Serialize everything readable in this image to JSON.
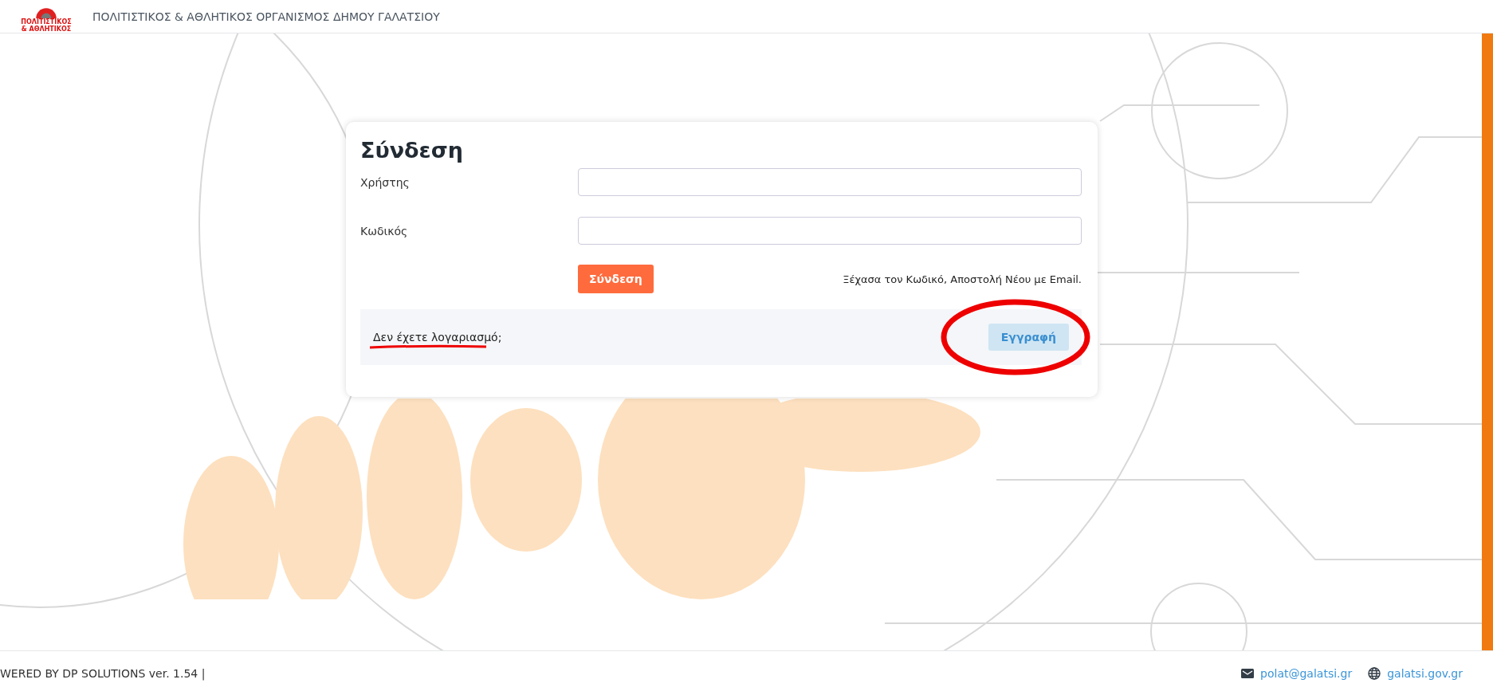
{
  "header": {
    "logo": {
      "line_1": "ΠΟΛΙΤΙΣΤΙΚΟΣ",
      "line_2": "& ΑΘΛΗΤΙΚΟΣ"
    },
    "title": "ΠΟΛΙΤΙΣΤΙΚΟΣ & ΑΘΛΗΤΙΚΟΣ ΟΡΓΑΝΙΣΜΟΣ ΔΗΜΟΥ ΓΑΛΑΤΣΙΟΥ"
  },
  "login_card": {
    "title": "Σύνδεση",
    "fields": [
      {
        "label": "Χρήστης"
      },
      {
        "label": "Κωδικός"
      }
    ],
    "submit_button": "Σύνδεση",
    "forgot_link": "Ξέχασα τον Κωδικό, Αποστολή Νέου με Email.",
    "register_panel": {
      "prompt": "Δεν έχετε λογαριασμό;",
      "button": "Εγγραφή"
    }
  },
  "footer": {
    "credit": "WERED BY DP SOLUTIONS ver. 1.54 |",
    "email": "polat@galatsi.gr",
    "website": "galatsi.gov.gr"
  }
}
